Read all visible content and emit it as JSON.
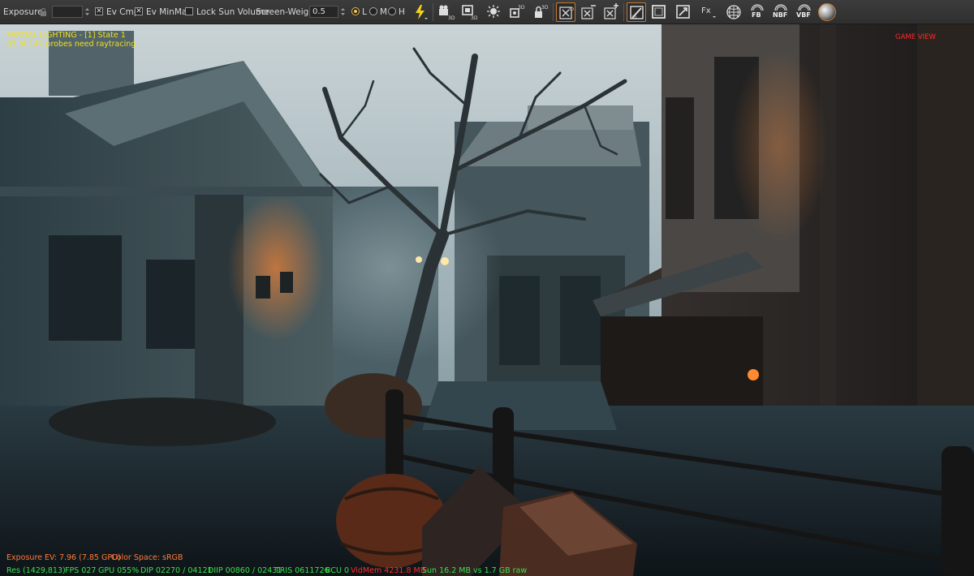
{
  "toolbar": {
    "exposure_label": "Exposure",
    "ev_cmp_label": "Ev Cmp",
    "ev_cmp_checked": true,
    "ev_minmax_label": "Ev MinMax",
    "ev_minmax_checked": true,
    "lock_sun_label": "Lock Sun Volume",
    "lock_sun_checked": false,
    "screen_weight_label": "Screen-Weight",
    "screen_weight_value": "0.5",
    "quality_options": [
      "L",
      "M",
      "H"
    ],
    "quality_selected": "L",
    "fx_label": "Fx",
    "fb_label": "FB",
    "nbf_label": "NBF",
    "vbf_label": "VBF",
    "icons": [
      "lightning-icon",
      "camera-3d-icon",
      "frame-3d-icon",
      "light-bulb-icon",
      "probe-3d-icon",
      "lock-3d-icon",
      "grid-3d-icon",
      "collapse-icon",
      "expand-icon",
      "screenshot-icon",
      "frame-icon",
      "diagonal-icon",
      "fx-icon",
      "grid-sphere-icon",
      "fb-icon",
      "nbf-icon",
      "vbf-icon",
      "material-sphere-icon"
    ],
    "accent_color": "#c87a2e"
  },
  "viewport": {
    "lighting_status": "PARTIAL LIGHTING - [1] State 1",
    "probe_status": "83 of 147 probes need raytracing",
    "view_label": "GAME VIEW",
    "exposure_info": "Exposure EV: 7.96 (7.85 GPU)",
    "color_space": "Color Space: sRGB"
  },
  "status": {
    "res": "Res (1429,813)",
    "fps": "FPS 027",
    "gpu": "GPU 055%",
    "dip": "DIP 02270 / 04121",
    "diip": "DIIP 00860 / 02431",
    "tris": "TRIS 0611726",
    "bcu": "BCU 0",
    "vidmem": "VidMem 4231.8 MB",
    "sun": "Sun 16.2 MB vs 1.7 GB raw"
  },
  "colors": {
    "overlay_yellow": "#f0e020",
    "overlay_red": "#ff2a2a",
    "overlay_orange": "#ff7a3a",
    "overlay_green": "#39e14a"
  }
}
